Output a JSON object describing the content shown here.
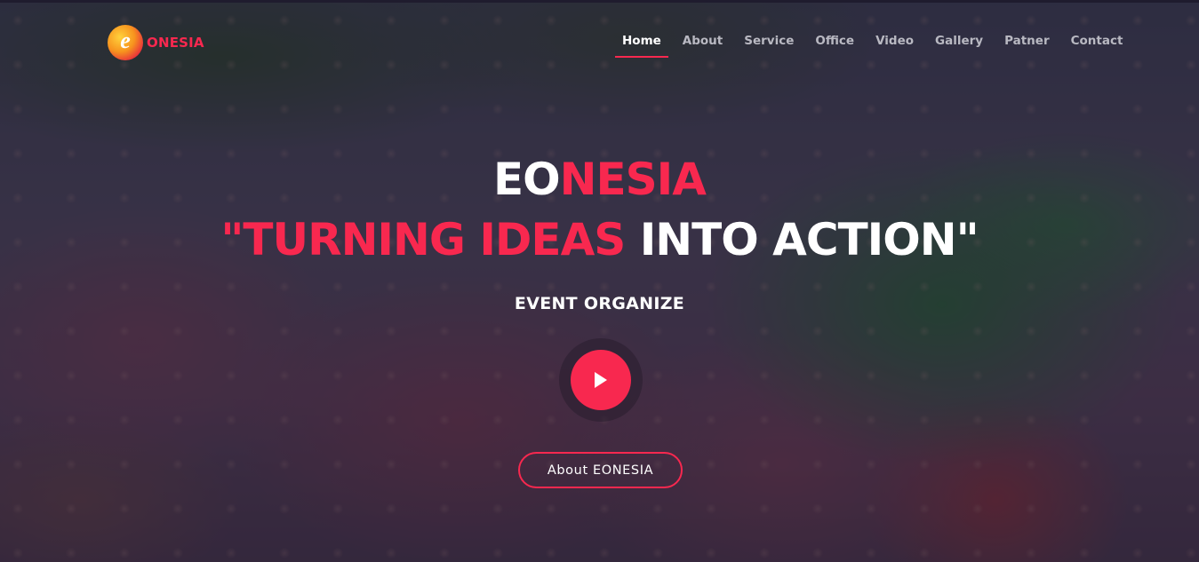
{
  "brand": {
    "logo_letter": "e",
    "name": "ONESIA",
    "accent_color": "#f8284f"
  },
  "nav": {
    "items": [
      {
        "label": "Home",
        "active": true
      },
      {
        "label": "About",
        "active": false
      },
      {
        "label": "Service",
        "active": false
      },
      {
        "label": "Office",
        "active": false
      },
      {
        "label": "Video",
        "active": false
      },
      {
        "label": "Gallery",
        "active": false
      },
      {
        "label": "Patner",
        "active": false
      },
      {
        "label": "Contact",
        "active": false
      }
    ]
  },
  "hero": {
    "title_white": "EO",
    "title_red": "NESIA",
    "tagline_red": "\"TURNING IDEAS",
    "tagline_white": " INTO ACTION\"",
    "subtitle": "EVENT ORGANIZE",
    "play_icon": "play-icon",
    "cta_label": "About EONESIA"
  }
}
